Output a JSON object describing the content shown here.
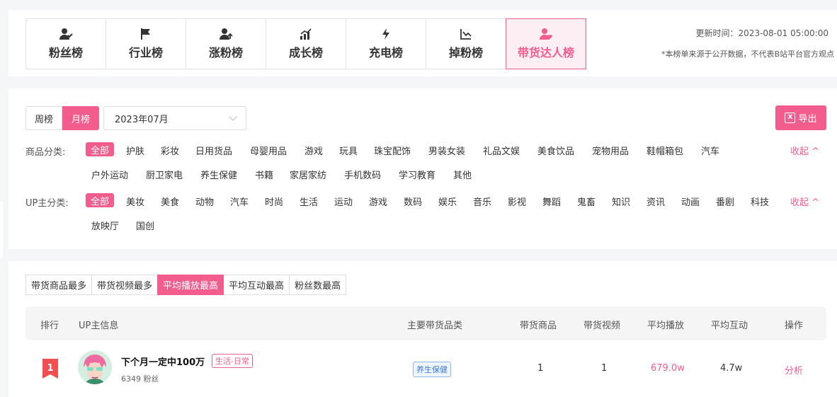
{
  "tabs": [
    {
      "label": "粉丝榜",
      "icon": "fans-user-icon"
    },
    {
      "label": "行业榜",
      "icon": "flag-icon"
    },
    {
      "label": "涨粉榜",
      "icon": "user-growth-icon"
    },
    {
      "label": "成长榜",
      "icon": "bar-chart-icon"
    },
    {
      "label": "充电榜",
      "icon": "lightning-icon"
    },
    {
      "label": "掉粉榜",
      "icon": "trend-down-icon"
    },
    {
      "label": "带货达人榜",
      "icon": "user-heart-icon"
    }
  ],
  "active_tab": "带货达人榜",
  "update_time": "更新时间：2023-08-01 05:00:00",
  "source_note": "*本榜单来源于公开数据，不代表B站平台官方观点",
  "period": {
    "weekly": "周榜",
    "monthly": "月榜",
    "active": "月榜"
  },
  "month_select": {
    "value": "2023年07月"
  },
  "export_label": "导出",
  "product_category": {
    "label": "商品分类:",
    "row1": [
      "全部",
      "护肤",
      "彩妆",
      "日用货品",
      "母婴用品",
      "游戏",
      "玩具",
      "珠宝配饰",
      "男装女装",
      "礼品文娱",
      "美食饮品",
      "宠物用品",
      "鞋帽箱包",
      "汽车"
    ],
    "row2": [
      "户外运动",
      "厨卫家电",
      "养生保健",
      "书籍",
      "家居家纺",
      "手机数码",
      "学习教育",
      "其他"
    ],
    "active": "全部",
    "collapse": "收起"
  },
  "up_category": {
    "label": "UP主分类:",
    "row1": [
      "全部",
      "美妆",
      "美食",
      "动物",
      "汽车",
      "时尚",
      "生活",
      "运动",
      "游戏",
      "数码",
      "娱乐",
      "音乐",
      "影视",
      "舞蹈",
      "鬼畜",
      "知识",
      "资讯",
      "动画",
      "番剧",
      "科技"
    ],
    "row2": [
      "放映厅",
      "国创"
    ],
    "active": "全部",
    "collapse": "收起"
  },
  "sort_tabs": [
    "带货商品最多",
    "带货视频最多",
    "平均播放最高",
    "平均互动最高",
    "粉丝数最高"
  ],
  "active_sort": "平均播放最高",
  "table": {
    "headers": {
      "rank": "排行",
      "up_info": "UP主信息",
      "main_category": "主要带货品类",
      "products": "带货商品",
      "videos": "带货视频",
      "avg_play": "平均播放",
      "avg_interact": "平均互动",
      "action": "操作"
    },
    "rows": [
      {
        "rank": "1",
        "name": "下个月一定中100万",
        "tag": "生活-日常",
        "fans": "6349 粉丝",
        "category": "养生保健",
        "products": "1",
        "videos": "1",
        "avg_play": "679.0w",
        "avg_interact": "4.7w",
        "action": "分析"
      }
    ]
  },
  "colors": {
    "accent": "#f25d8e",
    "active_tab_bg": "#fdeef3",
    "category_badge": "#3a7bd5"
  }
}
